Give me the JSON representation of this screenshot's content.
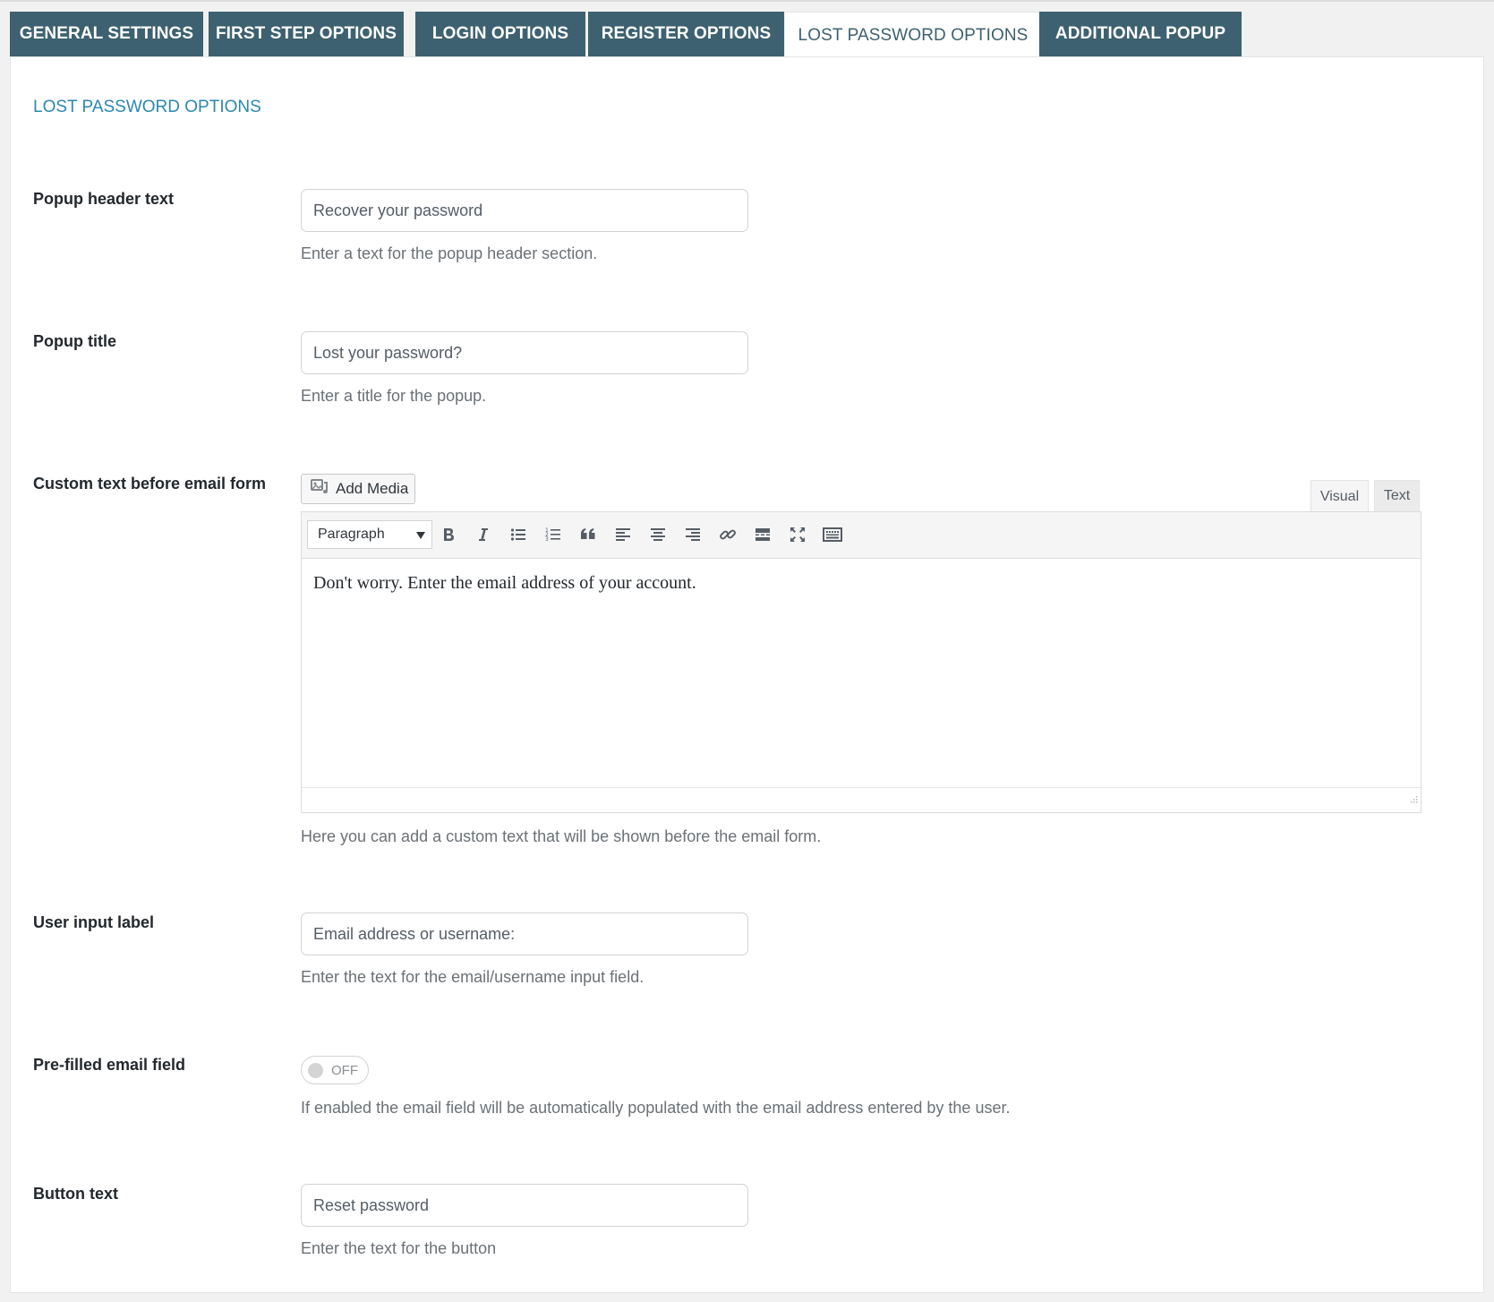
{
  "tabs": [
    {
      "label": "GENERAL SETTINGS",
      "active": false
    },
    {
      "label": "FIRST STEP OPTIONS",
      "active": false
    },
    {
      "label": "LOGIN OPTIONS",
      "active": false
    },
    {
      "label": "REGISTER OPTIONS",
      "active": false
    },
    {
      "label": "LOST PASSWORD OPTIONS",
      "active": true
    },
    {
      "label": "ADDITIONAL POPUP",
      "active": false
    }
  ],
  "section_title": "LOST PASSWORD OPTIONS",
  "fields": {
    "popup_header_text": {
      "label": "Popup header text",
      "value": "Recover your password",
      "description": "Enter a text for the popup header section."
    },
    "popup_title": {
      "label": "Popup title",
      "value": "Lost your password?",
      "description": "Enter a title for the popup."
    },
    "custom_text": {
      "label": "Custom text before email form",
      "add_media_label": "Add Media",
      "tab_visual": "Visual",
      "tab_text": "Text",
      "format_select": "Paragraph",
      "content": "Don't worry. Enter the email address of your account.",
      "description": "Here you can add a custom text that will be shown before the email form."
    },
    "user_input_label": {
      "label": "User input label",
      "value": "Email address or username:",
      "description": "Enter the text for the email/username input field."
    },
    "prefilled_email": {
      "label": "Pre-filled email field",
      "toggle_state": "OFF",
      "description": "If enabled the email field will be automatically populated with the email address entered by the user."
    },
    "button_text": {
      "label": "Button text",
      "value": "Reset password",
      "description": "Enter the text for the button"
    }
  },
  "colors": {
    "tab_bg": "#3d6170",
    "section_title": "#2c87b0"
  },
  "toolbar_icons": [
    "bold-icon",
    "italic-icon",
    "bullet-list-icon",
    "numbered-list-icon",
    "blockquote-icon",
    "align-left-icon",
    "align-center-icon",
    "align-right-icon",
    "link-icon",
    "read-more-icon",
    "fullscreen-icon",
    "toolbar-toggle-icon"
  ]
}
